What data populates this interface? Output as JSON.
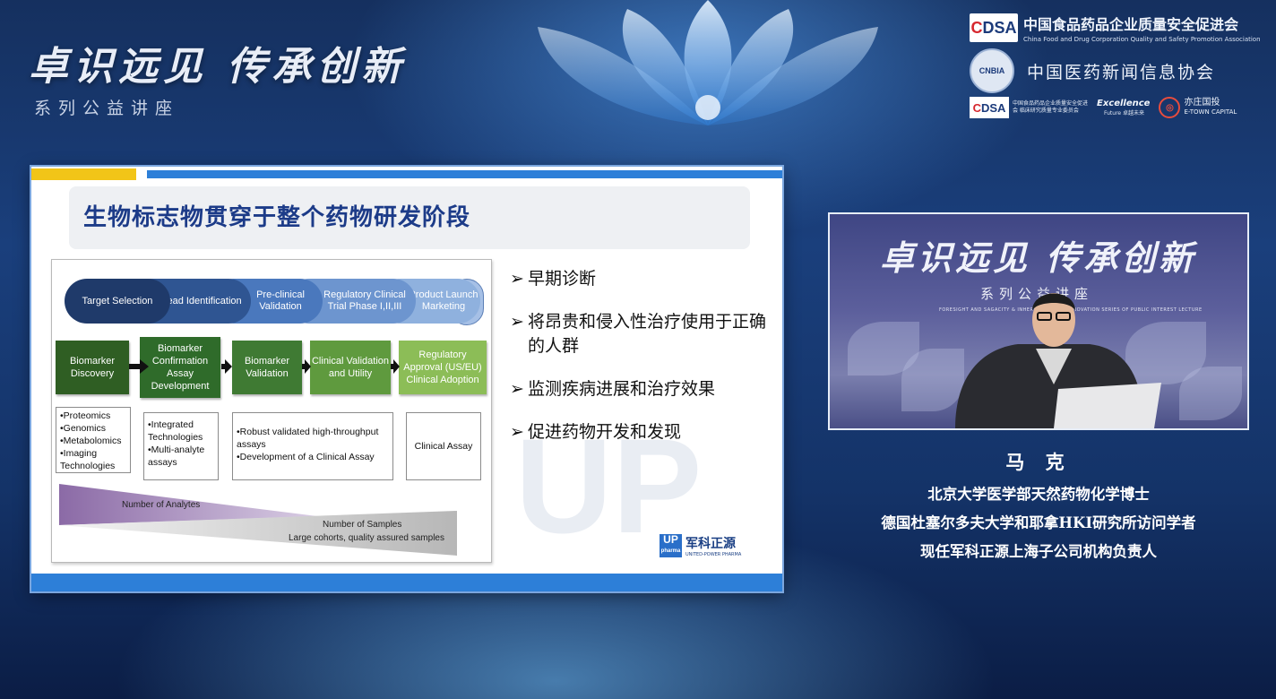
{
  "brand": {
    "title": "卓识远见 传承创新",
    "subtitle": "系列公益讲座"
  },
  "organizations": {
    "cfda": {
      "logo_text": "DSA",
      "logo_prefix": "C",
      "name_cn": "中国食品药品企业质量安全促进会",
      "name_en": "China Food and Drug Corporation Quality and Safety Promotion Association"
    },
    "cnbia": {
      "logo_text": "CNBIA",
      "name_cn": "中国医药新闻信息协会"
    },
    "dsa_small": {
      "logo_text": "DSA",
      "logo_prefix": "C",
      "caption": "中国食品药品企业质量安全促进会 临床研究质量专业委员会"
    },
    "excellence": {
      "text": "Excellence",
      "sub": "Future 卓越未来"
    },
    "etown": {
      "name_cn": "亦庄国投",
      "name_en": "E-TOWN CAPITAL"
    }
  },
  "slide": {
    "title": "生物标志物贯穿于整个药物研发阶段",
    "watermark": "UP",
    "phases": [
      "Target Selection",
      "Lead Identification",
      "Pre-clinical Validation",
      "Regulatory Clinical Trial Phase I,II,III",
      "Product Launch Marketing"
    ],
    "biomarker_steps": [
      "Biomarker Discovery",
      "Biomarker Confirmation Assay Development",
      "Biomarker Validation",
      "Clinical Validation and Utility",
      "Regulatory Approval (US/EU) Clinical Adoption"
    ],
    "tech_boxes": [
      [
        "•Proteomics",
        "•Genomics",
        "•Metabolomics",
        "•Imaging Technologies"
      ],
      [
        "•Integrated Technologies",
        "•Multi-analyte assays"
      ],
      [
        "•Robust validated high-throughput assays",
        "•Development of a Clinical Assay"
      ],
      [
        "Clinical Assay"
      ]
    ],
    "triangle_labels": {
      "analytes": "Number of Analytes",
      "samples": "Number of Samples",
      "cohorts": "Large cohorts, quality assured samples"
    },
    "bullets": [
      "早期诊断",
      "将昂贵和侵入性治疗使用于正确的人群",
      "监测疾病进展和治疗效果",
      "促进药物开发和发现"
    ],
    "bullet_marker": "➢",
    "logo": {
      "up_text": "UP",
      "up_sub": "pharma",
      "name_cn": "军科正源",
      "name_en": "UNITED-POWER PHARMA"
    },
    "colors": {
      "accent_yellow": "#f2c518",
      "accent_blue": "#2d7fd8",
      "title_blue": "#1c3b88",
      "green_dark": "#2f6b2a",
      "green_light": "#8cbd57"
    }
  },
  "video": {
    "title": "卓识远见 传承创新",
    "subtitle": "系列公益讲座",
    "small_text": "FORESIGHT AND SAGACITY & INHERITANCE AND INNOVATION SERIES OF PUBLIC INTEREST LECTURE"
  },
  "speaker": {
    "name": "马 克",
    "lines": [
      "北京大学医学部天然药物化学博士",
      "德国杜塞尔多夫大学和耶拿HKI研究所访问学者",
      "现任军科正源上海子公司机构负责人"
    ]
  }
}
